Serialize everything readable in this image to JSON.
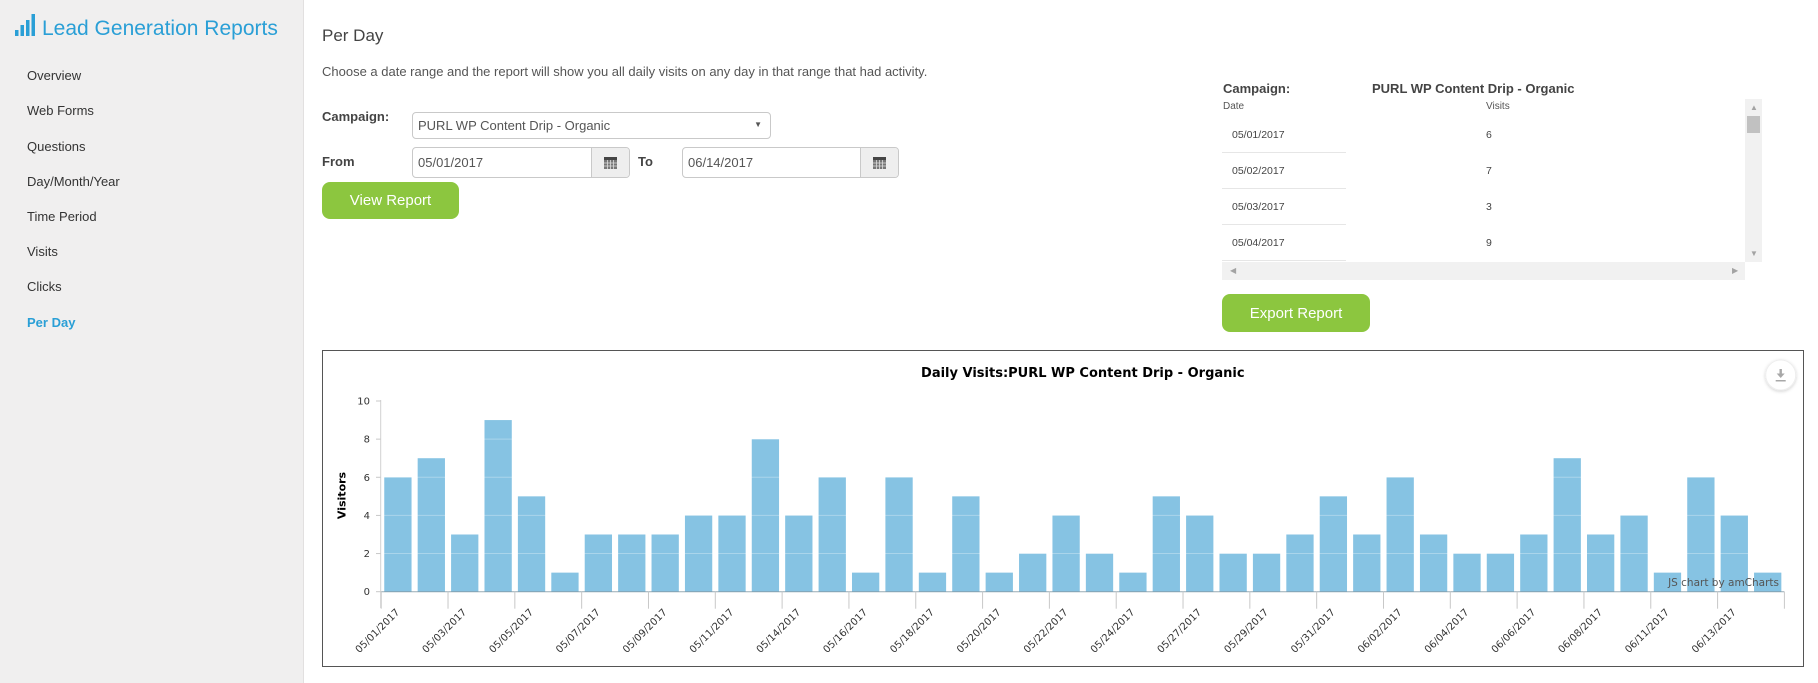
{
  "sidebar": {
    "title": "Lead Generation Reports",
    "icon": "bar-chart-icon",
    "items": [
      {
        "label": "Overview",
        "active": false
      },
      {
        "label": "Web Forms",
        "active": false
      },
      {
        "label": "Questions",
        "active": false
      },
      {
        "label": "Day/Month/Year",
        "active": false
      },
      {
        "label": "Time Period",
        "active": false
      },
      {
        "label": "Visits",
        "active": false
      },
      {
        "label": "Clicks",
        "active": false
      },
      {
        "label": "Per Day",
        "active": true
      }
    ]
  },
  "main": {
    "heading": "Per Day",
    "description": "Choose a date range and the report will show you all daily visits on any day in that range that had activity.",
    "form": {
      "campaign_label": "Campaign:",
      "campaign_selected": "PURL WP Content Drip - Organic",
      "from_label": "From",
      "from_value": "05/01/2017",
      "to_label": "To",
      "to_value": "06/14/2017",
      "view_report_label": "View Report"
    }
  },
  "summary": {
    "campaign_label": "Campaign:",
    "campaign_value": "PURL WP Content Drip - Organic",
    "columns": {
      "date": "Date",
      "visits": "Visits"
    },
    "rows": [
      {
        "date": "05/01/2017",
        "visits": "6"
      },
      {
        "date": "05/02/2017",
        "visits": "7"
      },
      {
        "date": "05/03/2017",
        "visits": "3"
      },
      {
        "date": "05/04/2017",
        "visits": "9"
      }
    ],
    "export_label": "Export Report"
  },
  "icons": {
    "brand": "bar-chart-icon",
    "calendar": "calendar-icon",
    "select": "caret-down-icon",
    "chart_export": "download-icon"
  },
  "colors": {
    "brand_blue": "#2a9fd6",
    "button_green": "#8cc63f",
    "bar": "#86c3e3"
  },
  "chart_data": {
    "type": "bar",
    "title": "Daily Visits:PURL WP Content Drip - Organic",
    "xlabel": "",
    "ylabel": "Visitors",
    "ylim": [
      0,
      10
    ],
    "yticks": [
      0,
      2,
      4,
      6,
      8,
      10
    ],
    "grid": true,
    "legend": "none",
    "credit": "JS chart by amCharts",
    "categories": [
      "05/01/2017",
      "",
      "05/03/2017",
      "",
      "05/05/2017",
      "",
      "05/07/2017",
      "",
      "05/09/2017",
      "",
      "05/11/2017",
      "",
      "05/14/2017",
      "",
      "05/16/2017",
      "",
      "05/18/2017",
      "",
      "05/20/2017",
      "",
      "05/22/2017",
      "",
      "05/24/2017",
      "",
      "05/27/2017",
      "",
      "05/29/2017",
      "",
      "05/31/2017",
      "",
      "06/02/2017",
      "",
      "06/04/2017",
      "",
      "06/06/2017",
      "",
      "06/08/2017",
      "",
      "06/11/2017",
      "",
      "06/13/2017",
      ""
    ],
    "values": [
      6,
      7,
      3,
      9,
      5,
      1,
      3,
      3,
      3,
      4,
      4,
      8,
      4,
      6,
      1,
      6,
      1,
      5,
      1,
      2,
      4,
      2,
      1,
      5,
      4,
      2,
      2,
      3,
      5,
      3,
      6,
      3,
      2,
      2,
      3,
      7,
      3,
      4,
      1,
      6,
      4,
      1
    ]
  }
}
